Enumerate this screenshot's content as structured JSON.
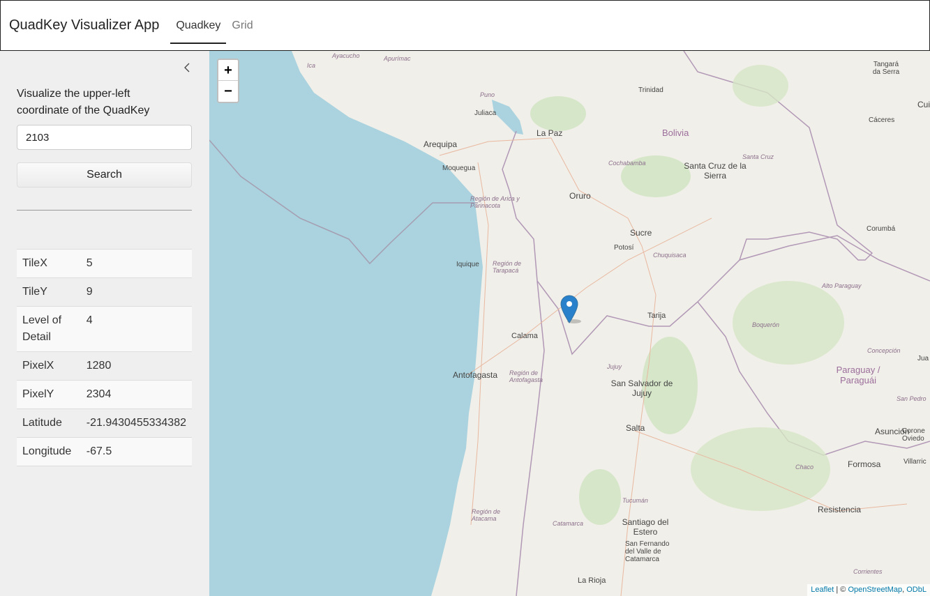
{
  "header": {
    "title": "QuadKey Visualizer App",
    "tabs": [
      {
        "label": "Quadkey",
        "active": true
      },
      {
        "label": "Grid",
        "active": false
      }
    ]
  },
  "sidebar": {
    "collapse_icon": "chevron-left-icon",
    "description": "Visualize the upper-left coordinate of the QuadKey",
    "input": {
      "value": "2103",
      "placeholder": ""
    },
    "search_label": "Search",
    "table": {
      "rows": [
        {
          "key": "TileX",
          "value": "5"
        },
        {
          "key": "TileY",
          "value": "9"
        },
        {
          "key": "Level of Detail",
          "value": "4"
        },
        {
          "key": "PixelX",
          "value": "1280"
        },
        {
          "key": "PixelY",
          "value": "2304"
        },
        {
          "key": "Latitude",
          "value": "-21.9430455334382"
        },
        {
          "key": "Longitude",
          "value": "-67.5"
        }
      ]
    }
  },
  "map": {
    "zoom_in": "+",
    "zoom_out": "−",
    "marker_icon": "map-pin-icon",
    "marker_color": "#2a81cb",
    "sea_color": "#aad3df",
    "land_color": "#f1efe9",
    "labels": [
      "Ayacucho",
      "Apurímac",
      "Ica",
      "Puno",
      "Juliaca",
      "Arequipa",
      "La Paz",
      "Trinidad",
      "Bolivia",
      "Cochabamba",
      "Santa Cruz",
      "Santa Cruz de la Sierra",
      "Cáceres",
      "Tangará da Serra",
      "Moquegua",
      "Región de Arica y Parinacota",
      "Oruro",
      "Sucre",
      "Potosí",
      "Chuquisaca",
      "Corumbá",
      "Iquique",
      "Región de Tarapacá",
      "Alto Paraguay",
      "Tarija",
      "Boquerón",
      "Calama",
      "Antofagasta",
      "Región de Antofagasta",
      "Jujuy",
      "San Salvador de Jujuy",
      "Salta",
      "Paraguay / Paraguái",
      "Concepción",
      "Formosa",
      "Asunción",
      "Chaco",
      "Tucumán",
      "Región de Atacama",
      "Catamarca",
      "Santiago del Estero",
      "San Fernando del Valle de Catamarca",
      "Resistencia",
      "Corrientes",
      "La Rioja",
      "San Pedro",
      "Villarric",
      "Corone Oviedo",
      "Cui",
      "Jua"
    ],
    "attribution": {
      "leaflet": "Leaflet",
      "separator": " | © ",
      "osm": "OpenStreetMap",
      "comma": ", ",
      "odbl": "ODbL"
    }
  }
}
